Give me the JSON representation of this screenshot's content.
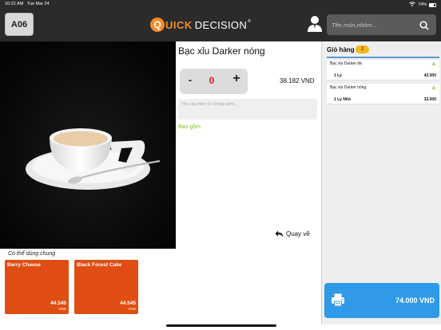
{
  "status_bar": {
    "time": "10:22 AM",
    "date": "Tue Mar 24",
    "battery": "74%"
  },
  "header": {
    "table_label": "A06",
    "logo_q": "Q",
    "logo_uick": "UICK",
    "logo_decision": "DECISION",
    "logo_reg": "®",
    "search_placeholder": "Tên món,nhóm..."
  },
  "product": {
    "name": "Bạc xỉu Darker nóng",
    "quantity": "0",
    "minus_label": "-",
    "plus_label": "+",
    "price": "38.182 VND",
    "note_placeholder": "Yêu cầu thêm (có không kèm)...",
    "included_label": "Bao gồm",
    "back_label": "Quay về"
  },
  "suggestions": {
    "title": "Có thể dùng chung",
    "items": [
      {
        "name": "Berry Cheese",
        "price": "44.545",
        "currency": "VND"
      },
      {
        "name": "Black Forest Cake",
        "price": "44.545",
        "currency": "VND"
      }
    ]
  },
  "cart": {
    "title": "Giỏ hàng",
    "count": "2",
    "add_symbol": "+",
    "items": [
      {
        "name": "Bạc xỉu Darker đá",
        "qty": "1 Ly",
        "total": "42.000"
      },
      {
        "name": "Bạc xỉu Darker nóng",
        "qty": "1 Ly Nhỏ",
        "total": "32.000"
      }
    ],
    "grand_total": "74.000 VND"
  },
  "colors": {
    "header_bg": "#2b2b2b",
    "accent_orange": "#e04d12",
    "checkout_blue": "#2f9be8",
    "green": "#7bbf2a",
    "badge_yellow": "#f3b71e"
  }
}
